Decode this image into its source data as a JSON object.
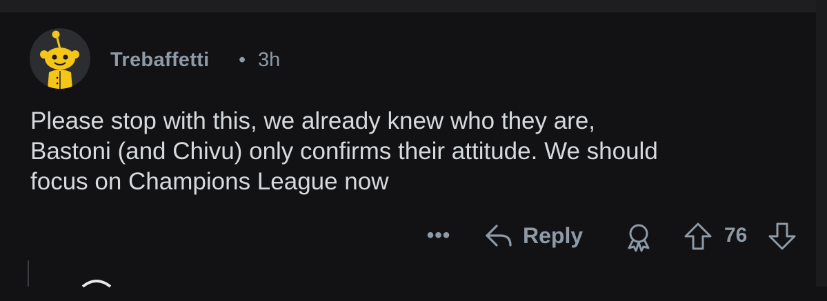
{
  "comment": {
    "username": "Trebaffetti",
    "separator": "•",
    "timestamp": "3h",
    "body_lines": [
      "Please stop with this, we already knew who they are,",
      "Bastoni (and Chivu) only confirms their attitude. We should",
      "focus on Champions League now"
    ]
  },
  "actions": {
    "more_label": "•••",
    "reply_label": "Reply",
    "vote_count": "76"
  },
  "icons": {
    "avatar": "snoo-avatar-icon",
    "reply": "reply-arrow-icon",
    "award": "award-icon",
    "upvote": "upvote-arrow-icon",
    "downvote": "downvote-arrow-icon"
  },
  "colors": {
    "background": "#121214",
    "text": "#d7dadc",
    "muted": "#8e9aa6",
    "avatar_bg": "#2b2d30",
    "snoo_yellow": "#f5c518"
  }
}
